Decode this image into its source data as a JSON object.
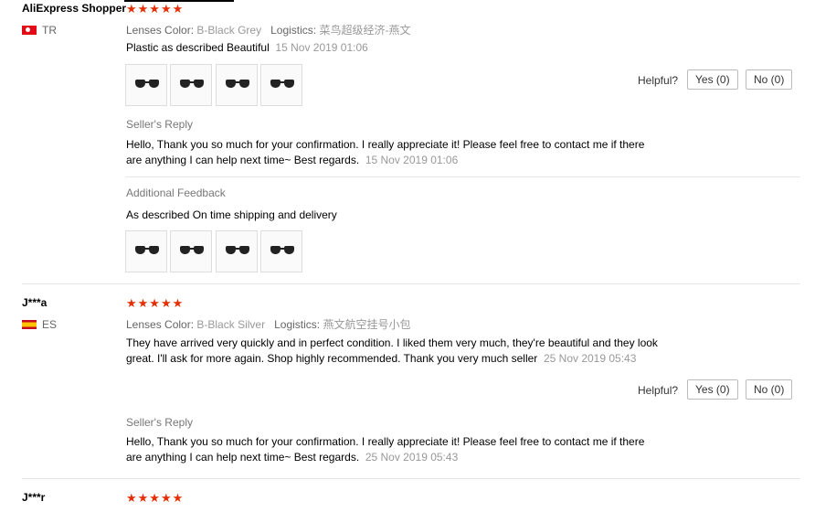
{
  "reviews": [
    {
      "user": "AliExpress Shopper",
      "stars": "★★★★★",
      "country": "TR",
      "color_label": "Lenses Color:",
      "color_value": "B-Black Grey",
      "logistics_label": "Logistics:",
      "logistics_value": "菜鸟超级经济-燕文",
      "text": "Plastic as described Beautiful",
      "date": "15 Nov 2019 01:06",
      "helpful_label": "Helpful?",
      "yes_label": "Yes (0)",
      "no_label": "No (0)",
      "reply_title": "Seller's Reply",
      "reply_text_1": "Hello, Thank you so much for your confirmation. I really appreciate it! Please feel free to contact me if there",
      "reply_text_2": "are anything I can help next time~ Best regards.",
      "reply_date": "15 Nov 2019 01:06",
      "additional_title": "Additional Feedback",
      "additional_text": "As described On time shipping and delivery"
    },
    {
      "user": "J***a",
      "stars": "★★★★★",
      "country": "ES",
      "color_label": "Lenses Color:",
      "color_value": "B-Black Silver",
      "logistics_label": "Logistics:",
      "logistics_value": "燕文航空挂号小包",
      "text_1": "They have arrived very quickly and in perfect condition. I liked them very much, they're beautiful and they look",
      "text_2": "great. I'll ask for more again. Shop highly recommended. Thank you very much seller",
      "date": "25 Nov 2019 05:43",
      "helpful_label": "Helpful?",
      "yes_label": "Yes (0)",
      "no_label": "No (0)",
      "reply_title": "Seller's Reply",
      "reply_text_1": "Hello, Thank you so much for your confirmation. I really appreciate it! Please feel free to contact me if there",
      "reply_text_2": "are anything I can help next time~ Best regards.",
      "reply_date": "25 Nov 2019 05:43"
    },
    {
      "user": "J***r",
      "stars": "★★★★★"
    }
  ]
}
